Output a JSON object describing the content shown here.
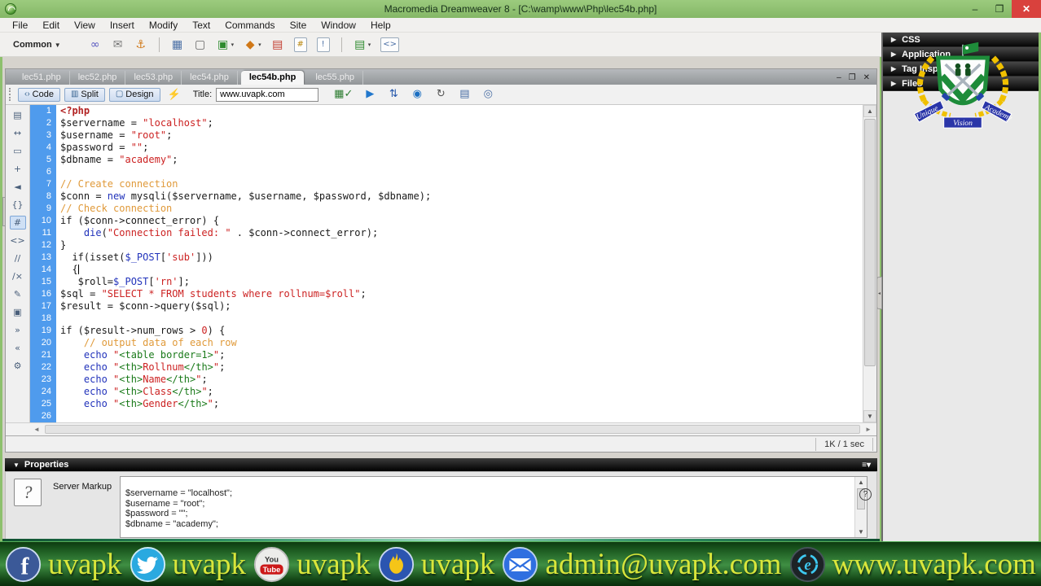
{
  "window": {
    "title": "Macromedia Dreamweaver 8 - [C:\\wamp\\www\\Php\\lec54b.php]",
    "minimize": "–",
    "restore": "❐",
    "close": "✕"
  },
  "menu": [
    "File",
    "Edit",
    "View",
    "Insert",
    "Modify",
    "Text",
    "Commands",
    "Site",
    "Window",
    "Help"
  ],
  "insert_bar": {
    "category": "Common",
    "category_arrow": "▼",
    "icons": [
      "hyperlink-icon",
      "email-link-icon",
      "named-anchor-icon",
      "separator",
      "table-icon",
      "insert-div-icon",
      "image-icon",
      "media-icon",
      "date-icon",
      "server-include-icon",
      "comment-icon",
      "separator",
      "template-icon",
      "tag-chooser-icon"
    ]
  },
  "tabs": [
    {
      "label": "lec51.php",
      "active": false
    },
    {
      "label": "lec52.php",
      "active": false
    },
    {
      "label": "lec53.php",
      "active": false
    },
    {
      "label": "lec54.php",
      "active": false
    },
    {
      "label": "lec54b.php",
      "active": true
    },
    {
      "label": "lec55.php",
      "active": false
    }
  ],
  "doc_window": {
    "minimize": "–",
    "restore": "❐",
    "close": "✕"
  },
  "doc_toolbar": {
    "code": "Code",
    "split": "Split",
    "design": "Design",
    "title_label": "Title:",
    "title_value": "www.uvapk.com",
    "right_icons": [
      "file-status-icon",
      "preview-debug-icon",
      "sync-updown-icon",
      "browser-check-icon",
      "refresh-icon",
      "view-options-icon",
      "visual-aids-icon"
    ]
  },
  "code_toolbar_icons": [
    "open-documents-icon",
    "collapse-full-tag-icon",
    "collapse-selection-icon",
    "expand-all-icon",
    "select-parent-tag-icon",
    "balance-braces-icon",
    "line-numbers-icon",
    "highlight-invalid-icon",
    "apply-comment-icon",
    "remove-comment-icon",
    "wrap-tag-icon",
    "recent-snippets-icon",
    "indent-icon",
    "outdent-icon",
    "format-source-icon"
  ],
  "code": {
    "cursor_line": 14,
    "lines": [
      {
        "n": 1,
        "s": [
          [
            "php",
            "<?php"
          ]
        ]
      },
      {
        "n": 2,
        "s": [
          [
            "d",
            "$servername = "
          ],
          [
            "s",
            "\"localhost\""
          ],
          [
            "d",
            ";"
          ]
        ]
      },
      {
        "n": 3,
        "s": [
          [
            "d",
            "$username = "
          ],
          [
            "s",
            "\"root\""
          ],
          [
            "d",
            ";"
          ]
        ]
      },
      {
        "n": 4,
        "s": [
          [
            "d",
            "$password = "
          ],
          [
            "s",
            "\"\""
          ],
          [
            "d",
            ";"
          ]
        ]
      },
      {
        "n": 5,
        "s": [
          [
            "d",
            "$dbname = "
          ],
          [
            "s",
            "\"academy\""
          ],
          [
            "d",
            ";"
          ]
        ]
      },
      {
        "n": 6,
        "s": []
      },
      {
        "n": 7,
        "s": [
          [
            "c",
            "// Create connection"
          ]
        ]
      },
      {
        "n": 8,
        "s": [
          [
            "d",
            "$conn = "
          ],
          [
            "k",
            "new"
          ],
          [
            "d",
            " mysqli($servername, $username, $password, $dbname);"
          ]
        ]
      },
      {
        "n": 9,
        "s": [
          [
            "c",
            "// Check connection"
          ]
        ]
      },
      {
        "n": 10,
        "s": [
          [
            "d",
            "if ($conn->connect_error) {"
          ]
        ]
      },
      {
        "n": 11,
        "s": [
          [
            "d",
            "    "
          ],
          [
            "k",
            "die"
          ],
          [
            "d",
            "("
          ],
          [
            "s",
            "\"Connection failed: \""
          ],
          [
            "d",
            " . $conn->connect_error);"
          ]
        ]
      },
      {
        "n": 12,
        "s": [
          [
            "d",
            "}"
          ]
        ]
      },
      {
        "n": 13,
        "s": [
          [
            "d",
            "  if(isset("
          ],
          [
            "k",
            "$_POST"
          ],
          [
            "d",
            "["
          ],
          [
            "s",
            "'sub'"
          ],
          [
            "d",
            "]))"
          ]
        ]
      },
      {
        "n": 14,
        "s": [
          [
            "d",
            "  {"
          ]
        ]
      },
      {
        "n": 15,
        "s": [
          [
            "d",
            "   $roll="
          ],
          [
            "k",
            "$_POST"
          ],
          [
            "d",
            "["
          ],
          [
            "s",
            "'rn'"
          ],
          [
            "d",
            "];"
          ]
        ]
      },
      {
        "n": 16,
        "s": [
          [
            "d",
            "$sql = "
          ],
          [
            "s",
            "\"SELECT * FROM students where rollnum=$roll\""
          ],
          [
            "d",
            ";"
          ]
        ]
      },
      {
        "n": 17,
        "s": [
          [
            "d",
            "$result = $conn->query($sql);"
          ]
        ]
      },
      {
        "n": 18,
        "s": []
      },
      {
        "n": 19,
        "s": [
          [
            "d",
            "if ($result->num_rows > "
          ],
          [
            "n",
            "0"
          ],
          [
            "d",
            ") {"
          ]
        ]
      },
      {
        "n": 20,
        "s": [
          [
            "c",
            "    // output data of each row"
          ]
        ]
      },
      {
        "n": 21,
        "s": [
          [
            "d",
            "    "
          ],
          [
            "k",
            "echo"
          ],
          [
            "d",
            " "
          ],
          [
            "s",
            "\""
          ],
          [
            "t",
            "<table border=1>"
          ],
          [
            "s",
            "\""
          ],
          [
            "d",
            ";"
          ]
        ]
      },
      {
        "n": 22,
        "s": [
          [
            "d",
            "    "
          ],
          [
            "k",
            "echo"
          ],
          [
            "d",
            " "
          ],
          [
            "s",
            "\""
          ],
          [
            "t",
            "<th>"
          ],
          [
            "s",
            "Rollnum"
          ],
          [
            "t",
            "</th>"
          ],
          [
            "s",
            "\""
          ],
          [
            "d",
            ";"
          ]
        ]
      },
      {
        "n": 23,
        "s": [
          [
            "d",
            "    "
          ],
          [
            "k",
            "echo"
          ],
          [
            "d",
            " "
          ],
          [
            "s",
            "\""
          ],
          [
            "t",
            "<th>"
          ],
          [
            "s",
            "Name"
          ],
          [
            "t",
            "</th>"
          ],
          [
            "s",
            "\""
          ],
          [
            "d",
            ";"
          ]
        ]
      },
      {
        "n": 24,
        "s": [
          [
            "d",
            "    "
          ],
          [
            "k",
            "echo"
          ],
          [
            "d",
            " "
          ],
          [
            "s",
            "\""
          ],
          [
            "t",
            "<th>"
          ],
          [
            "s",
            "Class"
          ],
          [
            "t",
            "</th>"
          ],
          [
            "s",
            "\""
          ],
          [
            "d",
            ";"
          ]
        ]
      },
      {
        "n": 25,
        "s": [
          [
            "d",
            "    "
          ],
          [
            "k",
            "echo"
          ],
          [
            "d",
            " "
          ],
          [
            "s",
            "\""
          ],
          [
            "t",
            "<th>"
          ],
          [
            "s",
            "Gender"
          ],
          [
            "t",
            "</th>"
          ],
          [
            "s",
            "\""
          ],
          [
            "d",
            ";"
          ]
        ]
      },
      {
        "n": 26,
        "s": []
      }
    ]
  },
  "status_bar": {
    "size_time": "1K / 1 sec"
  },
  "properties": {
    "title": "Properties",
    "label": "Server Markup",
    "help": "?",
    "content": [
      "$servername = \"localhost\";",
      "$username = \"root\";",
      "$password = \"\";",
      "$dbname = \"academy\";"
    ]
  },
  "sidebar": {
    "panels": [
      "CSS",
      "Application",
      "Tag Inspector",
      "Files"
    ],
    "logo": {
      "top": "Unique",
      "mid": "Vision",
      "bottom": "Academy"
    }
  },
  "footer": {
    "items": [
      {
        "icon": "facebook-icon",
        "label": "uvapk"
      },
      {
        "icon": "twitter-icon",
        "label": "uvapk"
      },
      {
        "icon": "youtube-icon",
        "label": "uvapk"
      },
      {
        "icon": "flame-icon",
        "label": "uvapk"
      },
      {
        "icon": "email-icon",
        "label": "admin@uvapk.com"
      },
      {
        "icon": "globe-icon",
        "label": "www.uvapk.com"
      }
    ]
  },
  "colors": {
    "titlebar_green": "#8dc06d",
    "gutter_blue": "#4f9bed",
    "string_red": "#cc2222",
    "comment_orange": "#e09a3a",
    "keyword_blue": "#2233bb",
    "tag_green": "#1a7a1a",
    "footer_text": "#d9e63b",
    "close_red": "#d9413d"
  }
}
